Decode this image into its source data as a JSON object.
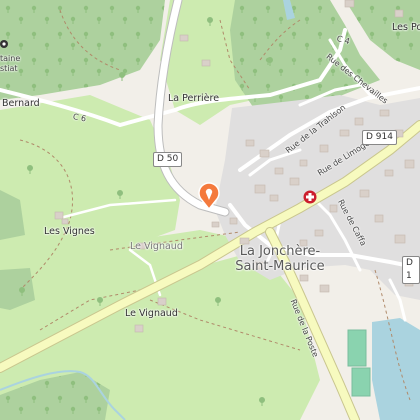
{
  "map": {
    "places": {
      "la_perriere": "La Perrière",
      "les_vignes": "Les Vignes",
      "le_vignaud_grey": "Le Vignaud",
      "le_vignaud": "Le Vignaud",
      "bernard": "Bernard",
      "fontaine_top": "taine",
      "fontaine_bottom": "stiat",
      "les_po": "Les Po",
      "town_line1": "La Jonchère-",
      "town_line2": "Saint-Maurice"
    },
    "streets": {
      "rue_de_limoges": "Rue de Limoges",
      "rue_de_la_poste": "Rue de la Poste",
      "rue_de_la_trahison": "Rue de la Trahison",
      "rue_des_chevailles": "Rue des Chevailles",
      "rue_de_caffa": "Rue de Caffa",
      "c6": "C 6",
      "c4": "C 4"
    },
    "road_badges": {
      "d50": "D 50",
      "d914": "D 914",
      "d1": "D 1"
    },
    "colors": {
      "forest": "#add19e",
      "meadow": "#cdebb0",
      "urban": "#e0dfdf",
      "primary_road": "#f7fabf",
      "water": "#aad3df",
      "pin": "#f47a3d",
      "pharmacy": "#cc1e2d"
    },
    "icons": [
      "location-pin-icon",
      "pharmacy-cross-icon",
      "viewpoint-icon",
      "tree-icon"
    ]
  }
}
